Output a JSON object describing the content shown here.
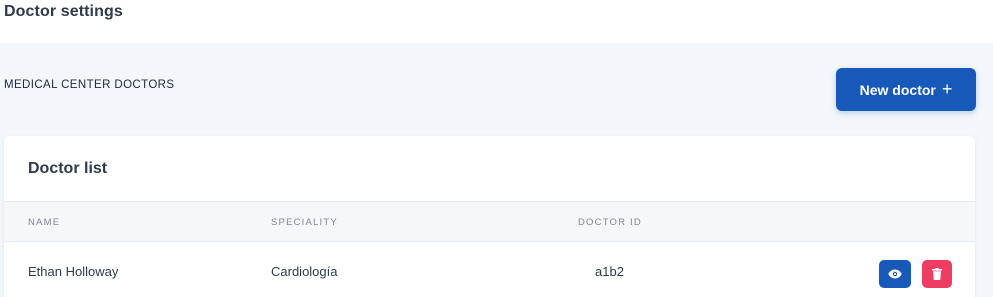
{
  "page": {
    "title": "Doctor settings"
  },
  "section": {
    "label": "MEDICAL CENTER DOCTORS",
    "new_button_label": "New doctor",
    "new_button_icon": "plus-icon"
  },
  "doctor_list": {
    "title": "Doctor list",
    "columns": [
      "NAME",
      "SPECIALITY",
      "DOCTOR ID"
    ],
    "rows": [
      {
        "name": "Ethan Holloway",
        "speciality": "Cardiología",
        "doctor_id": "a1b2",
        "actions": [
          "eye-icon",
          "trash-icon"
        ]
      }
    ]
  },
  "colors": {
    "primary": "#1659b8",
    "danger": "#ee3d62",
    "background": "#f3f7fb"
  }
}
